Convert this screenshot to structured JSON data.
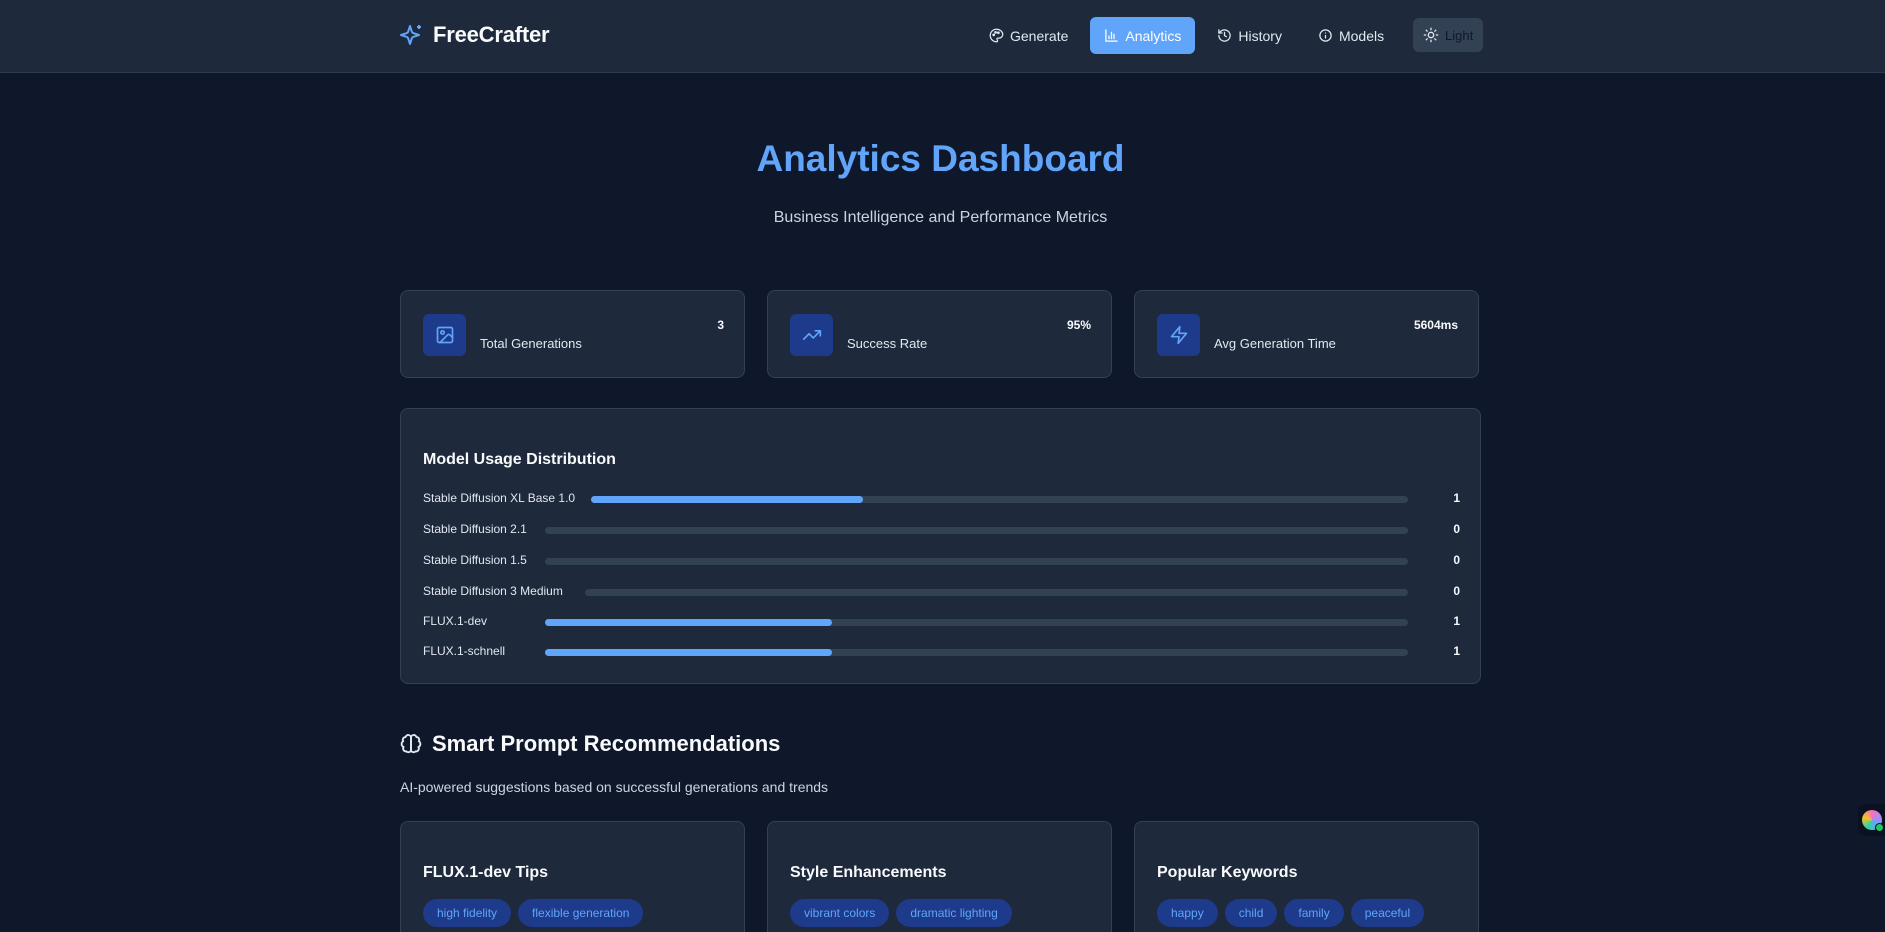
{
  "header": {
    "brand": "FreeCrafter",
    "nav": [
      {
        "label": "Generate",
        "icon": "palette-icon",
        "active": false
      },
      {
        "label": "Analytics",
        "icon": "bar-chart-icon",
        "active": true
      },
      {
        "label": "History",
        "icon": "history-icon",
        "active": false
      },
      {
        "label": "Models",
        "icon": "info-icon",
        "active": false
      }
    ],
    "theme_toggle": "Light"
  },
  "hero": {
    "title": "Analytics Dashboard",
    "subtitle": "Business Intelligence and Performance Metrics"
  },
  "stats": [
    {
      "label": "Total Generations",
      "value": "3",
      "icon": "image-icon"
    },
    {
      "label": "Success Rate",
      "value": "95%",
      "icon": "trending-up-icon"
    },
    {
      "label": "Avg Generation Time",
      "value": "5604ms",
      "icon": "zap-icon"
    }
  ],
  "model_usage": {
    "title": "Model Usage Distribution",
    "rows": [
      {
        "label": "Stable Diffusion XL Base 1.0",
        "count": "1",
        "fraction": 0.333
      },
      {
        "label": "Stable Diffusion 2.1",
        "count": "0",
        "fraction": 0
      },
      {
        "label": "Stable Diffusion 1.5",
        "count": "0",
        "fraction": 0
      },
      {
        "label": "Stable Diffusion 3 Medium",
        "count": "0",
        "fraction": 0
      },
      {
        "label": "FLUX.1-dev",
        "count": "1",
        "fraction": 0.333
      },
      {
        "label": "FLUX.1-schnell",
        "count": "1",
        "fraction": 0.333
      }
    ]
  },
  "recommendations": {
    "title": "Smart Prompt Recommendations",
    "subtitle": "AI-powered suggestions based on successful generations and trends",
    "cards": [
      {
        "title": "FLUX.1-dev Tips",
        "chips": [
          "high fidelity",
          "flexible generation"
        ]
      },
      {
        "title": "Style Enhancements",
        "chips": [
          "vibrant colors",
          "dramatic lighting"
        ]
      },
      {
        "title": "Popular Keywords",
        "chips": [
          "happy",
          "child",
          "family",
          "peaceful"
        ]
      }
    ]
  },
  "colors": {
    "background": "#0f172a",
    "surface": "#1e293b",
    "accent": "#60a5fa",
    "chip_bg": "#1e3a8a"
  }
}
